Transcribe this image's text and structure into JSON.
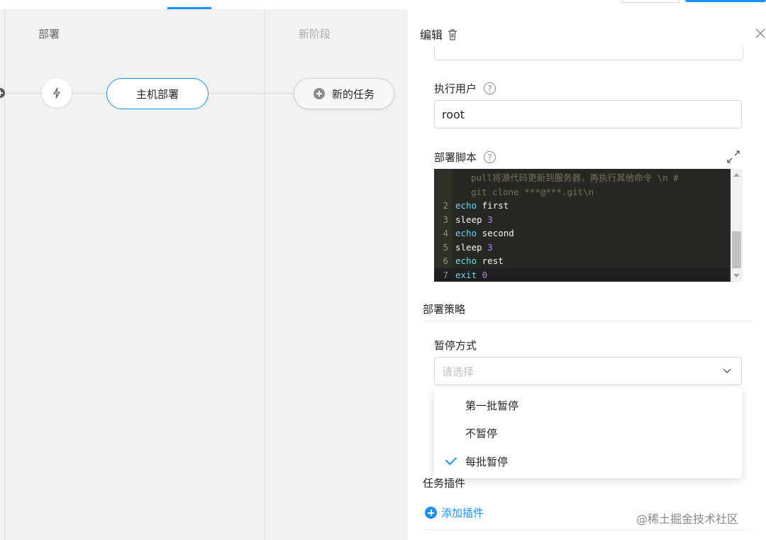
{
  "canvas": {
    "stages": [
      {
        "title": "部署"
      },
      {
        "title": "新阶段"
      }
    ],
    "task_node_label": "主机部署",
    "new_task_label": "新的任务"
  },
  "panel": {
    "title": "编辑",
    "exec_user": {
      "label": "执行用户",
      "value": "root",
      "help": "?"
    },
    "script": {
      "label": "部署脚本",
      "help": "?",
      "comment_lines": [
        "pull将源代码更新到服务器，再执行其他命令 \\n #",
        "git clone ***@***.git\\n"
      ],
      "lines": [
        {
          "n": "2",
          "kw": "echo",
          "arg": "first"
        },
        {
          "n": "3",
          "kw": "sleep",
          "arg": "3"
        },
        {
          "n": "4",
          "kw": "echo",
          "arg": "second"
        },
        {
          "n": "5",
          "kw": "sleep",
          "arg": "3"
        },
        {
          "n": "6",
          "kw": "echo",
          "arg": "rest"
        },
        {
          "n": "7",
          "kw": "exit",
          "arg": "0"
        }
      ]
    },
    "strategy": {
      "section_title": "部署策略",
      "pause_label": "暂停方式",
      "placeholder": "请选择",
      "options": [
        {
          "label": "第一批暂停",
          "selected": false
        },
        {
          "label": "不暂停",
          "selected": false
        },
        {
          "label": "每批暂停",
          "selected": true
        }
      ]
    },
    "plugins": {
      "section_title": "任务插件",
      "add_label": "添加插件"
    },
    "watermark": "@稀土掘金技术社区"
  },
  "colors": {
    "accent": "#1890ff",
    "editor_bg": "#272822",
    "keyword": "#66d9ef",
    "number": "#ae81ff"
  }
}
